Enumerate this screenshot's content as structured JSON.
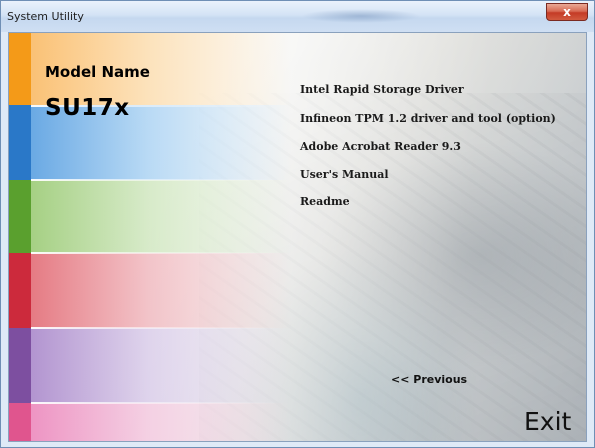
{
  "window": {
    "title": "System Utility",
    "close_icon": "close-icon",
    "close_glyph": "x"
  },
  "model": {
    "label": "Model Name",
    "value": "SU17x"
  },
  "menu": {
    "items": [
      {
        "label": "Intel Rapid Storage Driver"
      },
      {
        "label": "Infineon TPM 1.2 driver and tool (option)"
      },
      {
        "label": "Adobe Acrobat Reader 9.3"
      },
      {
        "label": "User's Manual"
      },
      {
        "label": "Readme"
      }
    ]
  },
  "navigation": {
    "previous_label": "<< Previous",
    "exit_label": "Exit"
  },
  "colors": {
    "strip": [
      "#f49a18",
      "#2a78c8",
      "#5aa02e",
      "#cc2a3c",
      "#7d4fa0",
      "#e0558e"
    ],
    "close_button": "#c43b26"
  }
}
